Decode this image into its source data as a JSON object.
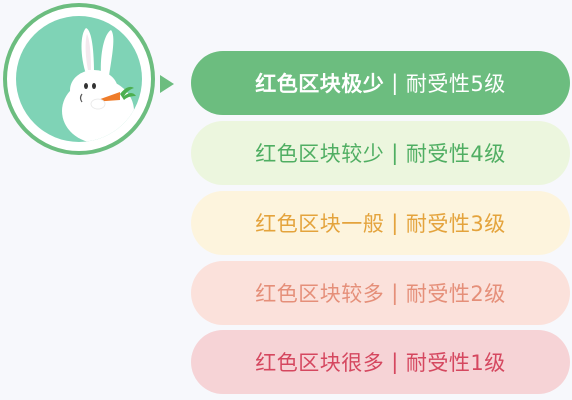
{
  "levels": [
    {
      "label": "红色区块极少",
      "separator": "|",
      "tolerance": "耐受性5级"
    },
    {
      "label": "红色区块较少",
      "separator": "|",
      "tolerance": "耐受性4级"
    },
    {
      "label": "红色区块一般",
      "separator": "|",
      "tolerance": "耐受性3级"
    },
    {
      "label": "红色区块较多",
      "separator": "|",
      "tolerance": "耐受性2级"
    },
    {
      "label": "红色区块很多",
      "separator": "|",
      "tolerance": "耐受性1级"
    }
  ],
  "colors": {
    "accent_green": "#6cbd7f",
    "level4_text": "#4fae62",
    "level3_text": "#e4a33c",
    "level2_text": "#e58f79",
    "level1_text": "#d5475f"
  },
  "mascot": {
    "icon": "rabbit-with-carrot-icon"
  }
}
